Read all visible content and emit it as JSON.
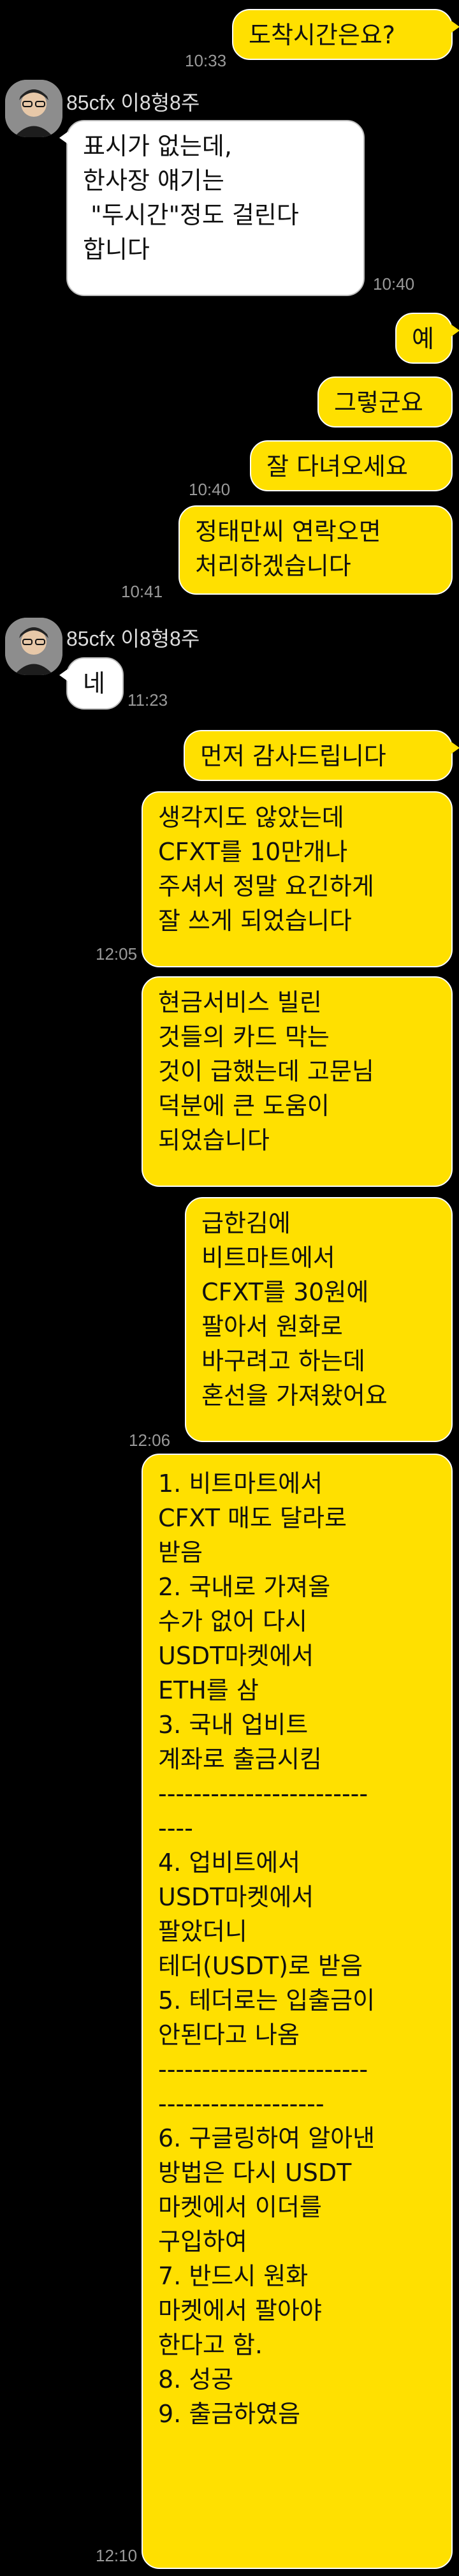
{
  "messages": [
    {
      "sender": "me",
      "text": "도착시간은요?",
      "time": "10:33"
    },
    {
      "sender": "other",
      "name": "85cfx 이8형8주",
      "text": "표시가 없는데,\n한사장 얘기는\n \"두시간\"정도 걸린다\n합니다",
      "time": "10:40"
    },
    {
      "sender": "me",
      "text": "예"
    },
    {
      "sender": "me",
      "text": "그렇군요"
    },
    {
      "sender": "me",
      "text": "잘 다녀오세요",
      "time": "10:40"
    },
    {
      "sender": "me",
      "text": "정태만씨 연락오면\n처리하겠습니다",
      "time": "10:41"
    },
    {
      "sender": "other",
      "name": "85cfx 이8형8주",
      "text": "네",
      "time": "11:23"
    },
    {
      "sender": "me",
      "text": "먼저 감사드립니다"
    },
    {
      "sender": "me",
      "text": "생각지도 않았는데\nCFXT를 10만개나\n주셔서 정말 요긴하게\n잘 쓰게 되었습니다",
      "time": "12:05"
    },
    {
      "sender": "me",
      "text": "현금서비스 빌린\n것들의 카드 막는\n것이 급했는데 고문님\n덕분에 큰 도움이\n되었습니다"
    },
    {
      "sender": "me",
      "text": "급한김에\n비트마트에서\nCFXT를 30원에\n팔아서 원화로\n바구려고 하는데\n혼선을 가져왔어요",
      "time": "12:06"
    },
    {
      "sender": "me",
      "text": "1. 비트마트에서\nCFXT 매도 달라로\n받음\n2. 국내로 가져올\n수가 없어 다시\nUSDT마켓에서\nETH를 삼\n3. 국내 업비트\n계좌로 출금시킴\n------------------------\n----\n4. 업비트에서\nUSDT마켓에서\n팔았더니\n테더(USDT)로 받음\n5. 테더로는 입출금이\n안된다고 나옴\n------------------------\n-------------------\n6. 구글링하여 알아낸\n방법은 다시 USDT\n마켓에서 이더를\n구입하여\n7. 반드시 원화\n마켓에서 팔아야\n한다고 함.\n8. 성공\n9. 출금하였음",
      "time": "12:10"
    }
  ]
}
